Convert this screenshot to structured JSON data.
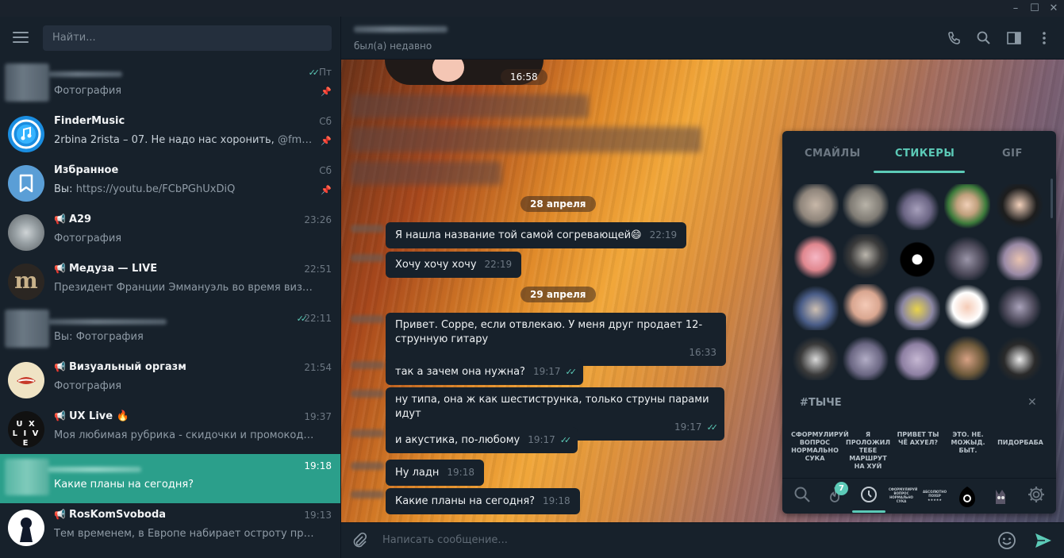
{
  "window": {
    "minimize": "–",
    "maximize": "☐",
    "close": "✕"
  },
  "search": {
    "placeholder": "Найти..."
  },
  "chats": [
    {
      "name": "",
      "message": "Фотография",
      "time": "Пт",
      "pinned": true,
      "read": true
    },
    {
      "name": "FinderMusic",
      "message_prefix": "2rbina 2rista – 07. Не надо нас хоронить, ",
      "message": "@fmusbot ...",
      "time": "Сб",
      "pinned": true
    },
    {
      "name": "Избранное",
      "message_prefix": "Вы: ",
      "message": "https://youtu.be/FCbPGhUxDiQ",
      "time": "Сб",
      "pinned": true
    },
    {
      "name": "A29",
      "message": "Фотография",
      "time": "23:26",
      "channel": true
    },
    {
      "name": "Медуза — LIVE",
      "message": "Президент Франции Эммануэль во время визита в СШ...",
      "time": "22:51",
      "channel": true
    },
    {
      "name": "",
      "message": "Вы: Фотография",
      "time": "22:11",
      "read": true
    },
    {
      "name": "Визуальный оргазм",
      "message": "Фотография",
      "time": "21:54",
      "channel": true
    },
    {
      "name": "UX Live 🔥",
      "message": "Моя любимая рубрика - скидочки и промокоды.  Я уж...",
      "time": "19:37",
      "channel": true
    },
    {
      "name": "",
      "message": "Какие планы на сегодня?",
      "time": "19:18",
      "active": true
    },
    {
      "name": "RosKomSvoboda",
      "message": "Тем временем, в Европе набирает остроту противосто...",
      "time": "19:13",
      "channel": true
    }
  ],
  "header": {
    "status": "был(а) недавно"
  },
  "messages": {
    "photo_time": "16:58",
    "date1": "28 апреля",
    "date2": "29 апреля",
    "m1": {
      "text": "Я нашла название той самой согревающей😄",
      "time": "22:19"
    },
    "m2": {
      "text": "Хочу хочу хочу",
      "time": "22:19"
    },
    "m3": {
      "text": "Привет. Сорре, если отвлекаю. У меня друг продает 12-струнную гитару",
      "time": "16:33"
    },
    "m4": {
      "text": "так а зачем она нужна?",
      "time": "19:17"
    },
    "m5": {
      "text": "ну типа, она ж как шестиструнка, только струны парами идут",
      "time": "19:17"
    },
    "m6": {
      "text": "и акустика, по-любому",
      "time": "19:17"
    },
    "m7": {
      "text": "Ну ладн",
      "time": "19:18"
    },
    "m8": {
      "text": "Какие планы на сегодня?",
      "time": "19:18"
    }
  },
  "input": {
    "placeholder": "Написать сообщение..."
  },
  "panel": {
    "tabs": [
      "СМАЙЛЫ",
      "СТИКЕРЫ",
      "GIF"
    ],
    "active_tab": "СТИКЕРЫ",
    "set_title": "#ТЫЧЕ",
    "text_stickers": [
      "СФОРМУЛИРУЙ ВОПРОС НОРМАЛЬНО СУКА",
      "Я ПРОЛОЖИЛ ТЕБЕ МАРШРУТ НА ХУЙ",
      "ПРИВЕТ ТЫ ЧЁ АХУЕЛ?",
      "ЭТО. НЕ. МОЖЫД. БЫТ.",
      "ПИДОРБАБА"
    ],
    "badge": "7",
    "mini1": "СФОРМУЛИРУЙ ВОПРОС НОРМАЛЬНО СУКА",
    "mini2": "АБСОЛЮТНО ПОХЕР ★★★★★"
  },
  "colors": {
    "accent": "#5ccab7",
    "active_chat": "#2b9f8b",
    "bg": "#17212b"
  }
}
